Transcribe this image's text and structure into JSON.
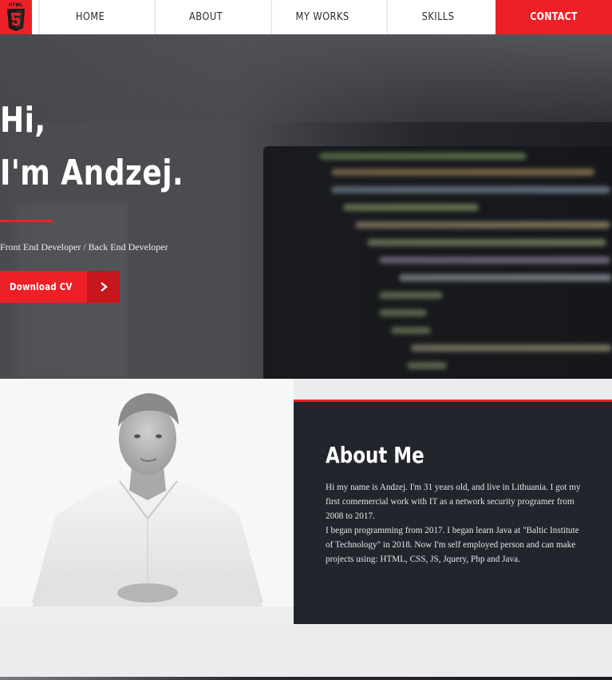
{
  "logo": {
    "text": "HTML",
    "digit": "5"
  },
  "nav": {
    "items": [
      {
        "label": "Home"
      },
      {
        "label": "About"
      },
      {
        "label": "My works"
      },
      {
        "label": "Skills"
      }
    ],
    "contact_label": "Contact"
  },
  "hero": {
    "greeting": "Hi,",
    "name_line": "I'm Andzej.",
    "subtitle": "Front End Developer / Back End Developer",
    "cv_button_label": "Download CV",
    "cv_button_icon": "chevron-right-icon"
  },
  "about": {
    "title": "About Me",
    "paragraphs": [
      "Hi my name is Andzej. I'm 31 years old, and live in Lithuania. I got my first comemercial work with IT as a network security programer from 2008 to 2017.",
      "I began programming from 2017. I began learn Java at \"Baltic Institute of Technology\" in 2018. Now I'm self employed person and can make projects using: HTML, CSS, JS, Jquery, Php and Java."
    ]
  },
  "colors": {
    "accent": "#ed2027",
    "accent_dark": "#c8161d",
    "panel": "#22252b",
    "band": "#ebecee"
  }
}
